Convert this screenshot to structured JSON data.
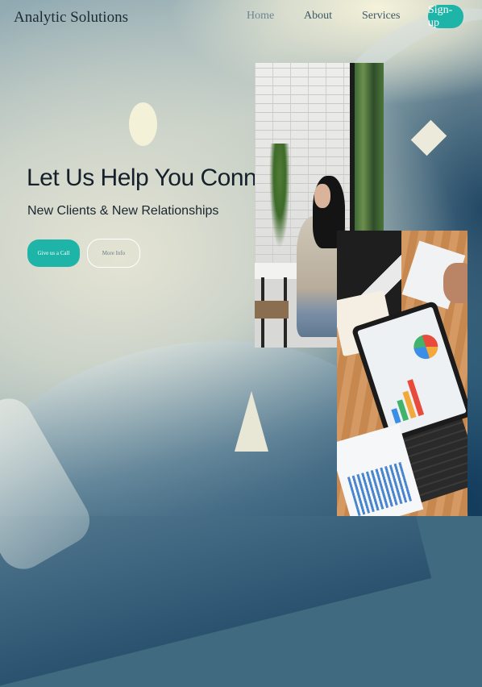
{
  "brand": {
    "name": "Analytic Solutions"
  },
  "nav": {
    "items": [
      {
        "label": "Home"
      },
      {
        "label": "About"
      },
      {
        "label": "Services"
      }
    ],
    "signup_label": "Sign-up"
  },
  "hero": {
    "title": "Let Us Help You Connect!",
    "subtitle": "New Clients & New Relationships",
    "primary_button": "Give us a Call",
    "secondary_button": "More Info"
  },
  "colors": {
    "accent": "#1fb4a8",
    "text_dark": "#15202a",
    "shape_cream": "#f4f1d9"
  },
  "images": [
    {
      "name": "woman-cafe-photo"
    },
    {
      "name": "business-meeting-tablet-photo"
    }
  ]
}
